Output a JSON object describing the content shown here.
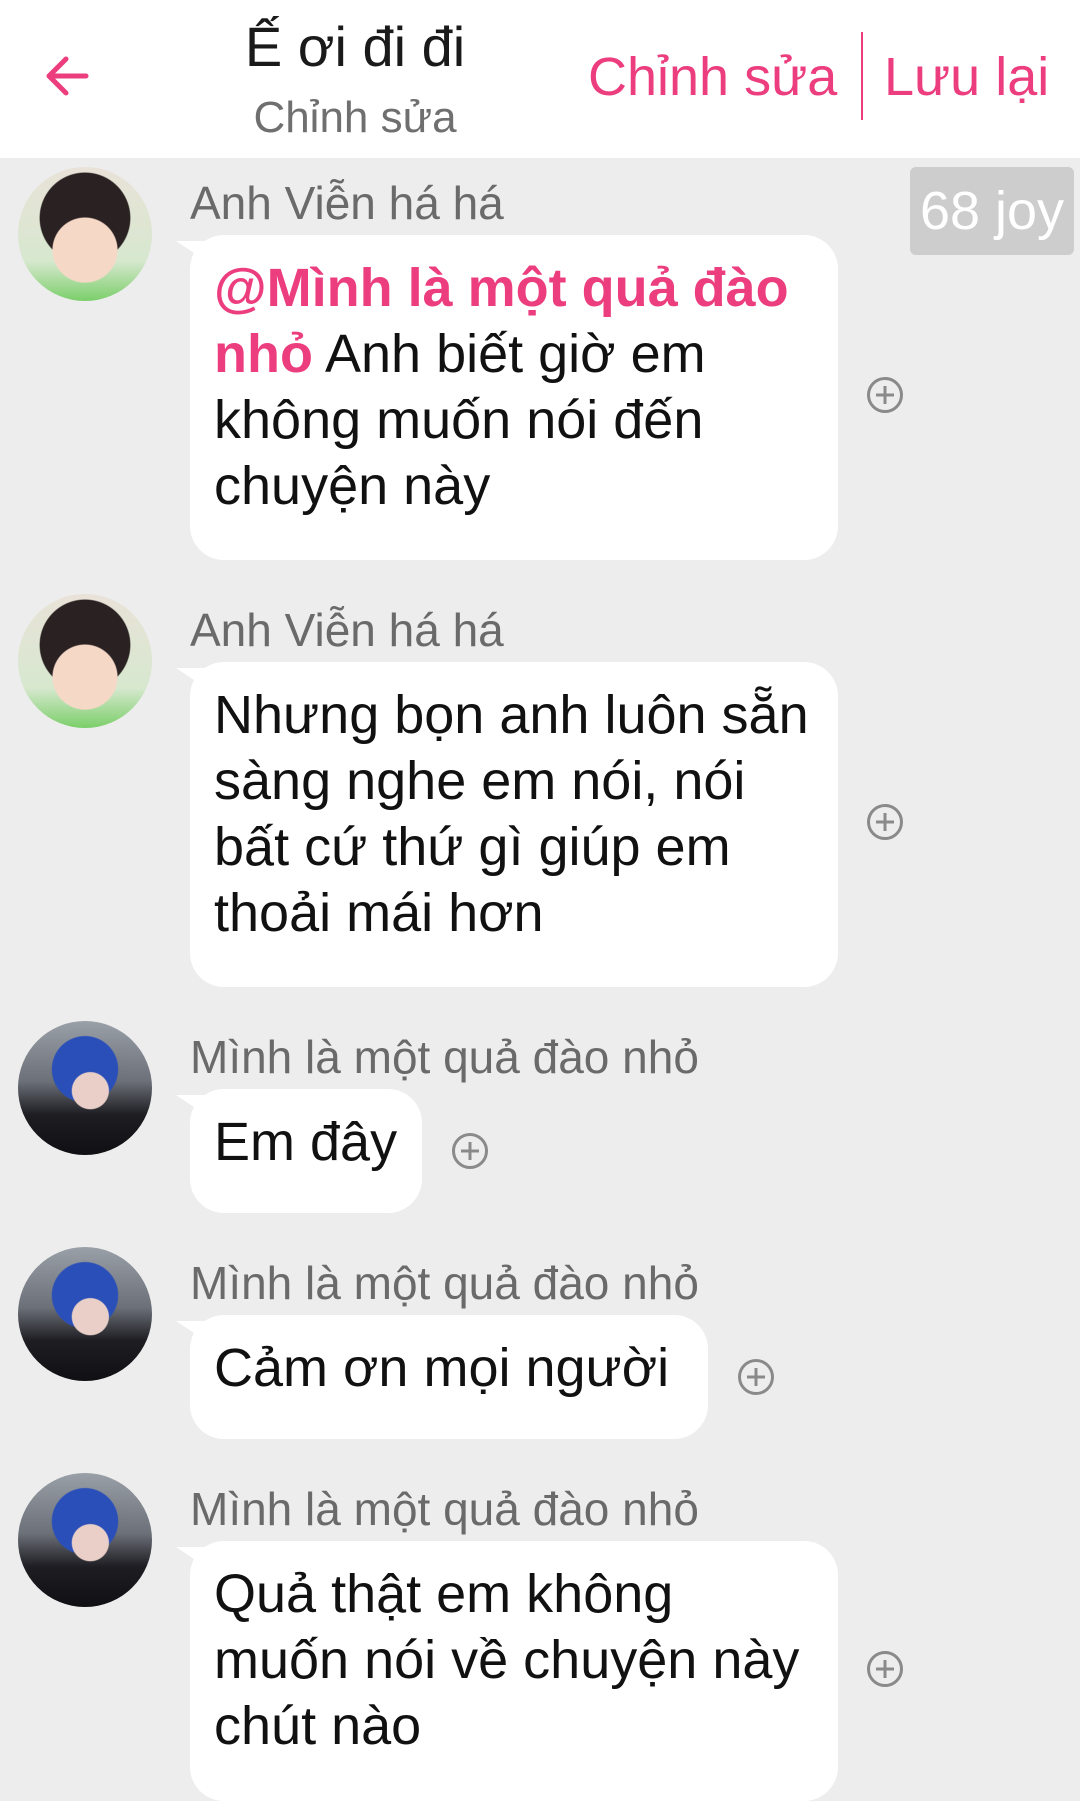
{
  "header": {
    "title": "Ế ơi đi đi",
    "subtitle": "Chỉnh sửa",
    "edit_label": "Chỉnh sửa",
    "save_label": "Lưu lại"
  },
  "badge": {
    "text": "68 joy"
  },
  "messages": [
    {
      "sender": "Anh Viễn há há",
      "mention": "@Mình là một quả đào nhỏ",
      "text": " Anh biết giờ em không muốn nói đến chuyện này"
    },
    {
      "sender": "Anh Viễn há há",
      "text": "Nhưng bọn anh luôn sẵn sàng nghe em nói, nói bất cứ thứ gì giúp em thoải mái hơn"
    },
    {
      "sender": "Mình là một quả đào nhỏ",
      "text": "Em đây"
    },
    {
      "sender": "Mình là một quả đào nhỏ",
      "text": "Cảm ơn mọi người"
    },
    {
      "sender": "Mình là một quả đào nhỏ",
      "text": "Quả thật em không muốn nói về chuyện này chút nào"
    }
  ],
  "icons": {
    "back": "arrow-left-icon",
    "add_reaction": "plus-circle-icon"
  },
  "colors": {
    "accent": "#ec3d7e",
    "background": "#ededed",
    "bubble": "#ffffff"
  }
}
